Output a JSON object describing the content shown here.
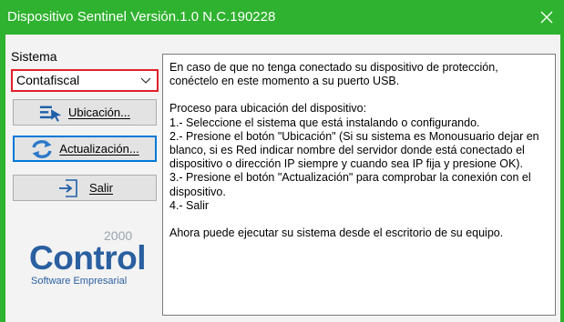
{
  "window": {
    "title": "Dispositivo Sentinel Versión.1.0 N.C.190228",
    "accent_color": "#2fb22f",
    "close_icon": "close-icon"
  },
  "sidebar": {
    "sistema_label": "Sistema",
    "sistema_selected": "Contafiscal",
    "buttons": {
      "ubicacion": {
        "label": "Ubicación...",
        "icon": "cursor-list-icon"
      },
      "actualizacion": {
        "label": "Actualización...",
        "icon": "refresh-arrows-icon"
      },
      "salir": {
        "label": "Salir",
        "icon": "exit-arrow-icon"
      }
    },
    "logo": {
      "year": "2000",
      "brand": "Control",
      "tagline": "Software Empresarial"
    }
  },
  "info": {
    "para1": "En caso de que no tenga conectado su dispositivo de protección, conéctelo en este momento a su puerto USB.",
    "heading": "Proceso para ubicación del dispositivo:",
    "step1": "1.- Seleccione el sistema que está instalando o configurando.",
    "step2": "2.- Presione el botón \"Ubicación\" (Si su sistema es Monousuario dejar en blanco, si es Red indicar nombre del servidor donde está conectado el dispositivo o dirección IP siempre y cuando sea IP fija y presione OK).",
    "step3": "3.- Presione el botón \"Actualización\" para comprobar la conexión con el dispositivo.",
    "step4": "4.- Salir",
    "footer": "Ahora puede ejecutar su sistema desde el escritorio de su equipo."
  }
}
